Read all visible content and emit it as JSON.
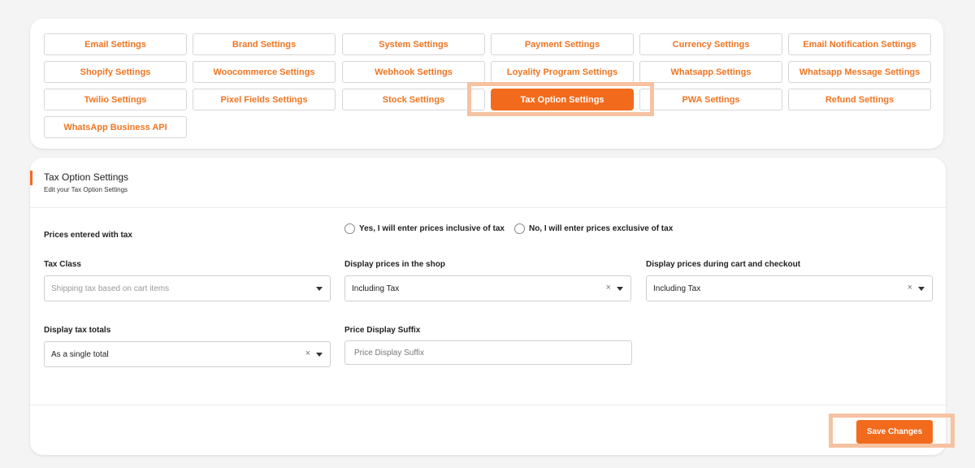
{
  "settings_nav": {
    "buttons": [
      "Email Settings",
      "Brand Settings",
      "System Settings",
      "Payment Settings",
      "Currency Settings",
      "Email Notification Settings",
      "Shopify Settings",
      "Woocommerce Settings",
      "Webhook Settings",
      "Loyality Program Settings",
      "Whatsapp Settings",
      "Whatsapp Message Settings",
      "Twilio Settings",
      "Pixel Fields Settings",
      "Stock Settings",
      "Tax Option Settings",
      "PWA Settings",
      "Refund Settings",
      "WhatsApp Business API"
    ],
    "active": "Tax Option Settings"
  },
  "form": {
    "title": "Tax Option Settings",
    "subtitle": "Edit your Tax Option Settings",
    "prices_entered_label": "Prices entered with tax",
    "radio_inclusive": "Yes, I will enter prices inclusive of tax",
    "radio_exclusive": "No, I will enter prices exclusive of tax",
    "tax_class": {
      "label": "Tax Class",
      "placeholder": "Shipping tax based on cart items"
    },
    "display_shop": {
      "label": "Display prices in the shop",
      "value": "Including Tax"
    },
    "display_cart": {
      "label": "Display prices during cart and checkout",
      "value": "Including Tax"
    },
    "tax_totals": {
      "label": "Display tax totals",
      "value": "As a single total"
    },
    "suffix": {
      "label": "Price Display Suffix",
      "placeholder": "Price Display Suffix"
    },
    "save_label": "Save Changes",
    "clear_glyph": "×"
  },
  "colors": {
    "accent": "#f26b1d",
    "highlight": "#f6c2a1"
  }
}
